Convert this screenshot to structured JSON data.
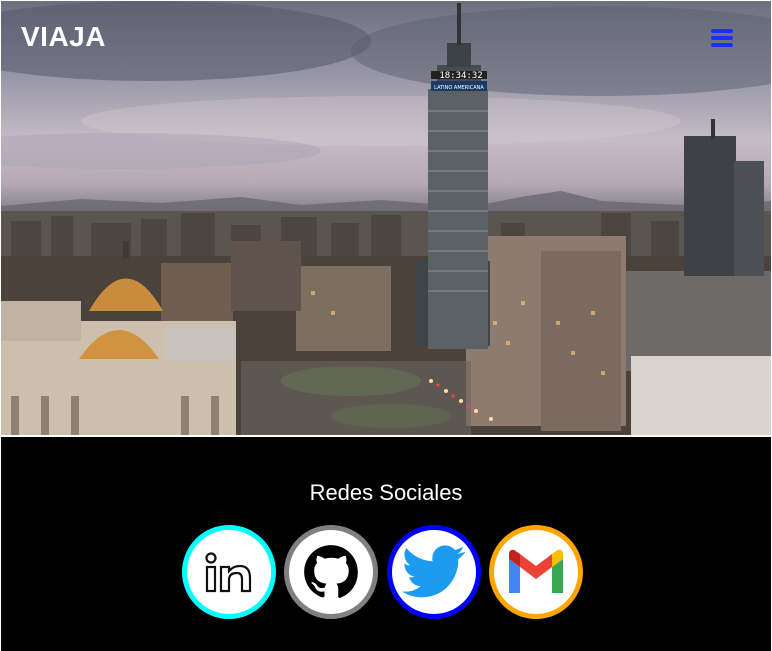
{
  "header": {
    "brand": "VIAJA",
    "menu_icon": "hamburger-menu-icon",
    "menu_color": "#1a2fff"
  },
  "hero": {
    "image": "city-skyline-photo",
    "tower_clock": "18:34:32",
    "tower_sign": "LATINO AMERICANA"
  },
  "footer": {
    "title": "Redes Sociales",
    "social": [
      {
        "name": "LinkedIn",
        "icon": "linkedin-icon",
        "ring_color": "#00ffff"
      },
      {
        "name": "GitHub",
        "icon": "github-icon",
        "ring_color": "#808080"
      },
      {
        "name": "Twitter",
        "icon": "twitter-icon",
        "ring_color": "#0000ff"
      },
      {
        "name": "Gmail",
        "icon": "gmail-icon",
        "ring_color": "#ffa500"
      }
    ]
  }
}
